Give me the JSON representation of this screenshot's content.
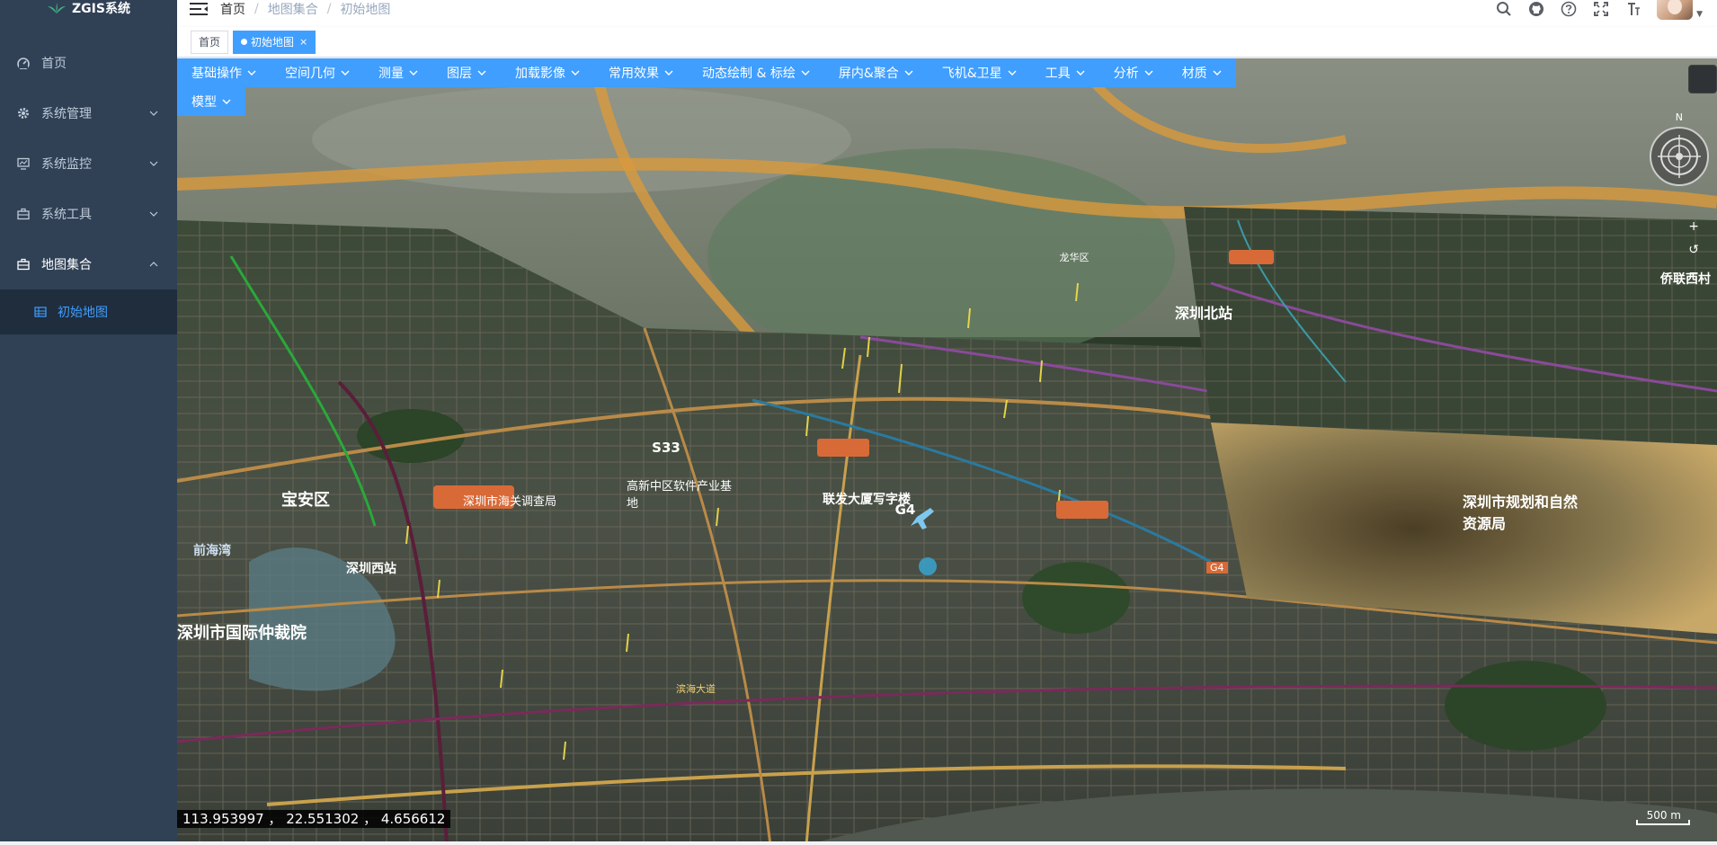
{
  "app": {
    "logo_text": "ZGIS系统"
  },
  "sidebar": {
    "items": [
      {
        "label": "首页",
        "icon": "dashboard-icon"
      },
      {
        "label": "系统管理",
        "icon": "gear-icon"
      },
      {
        "label": "系统监控",
        "icon": "monitor-icon"
      },
      {
        "label": "系统工具",
        "icon": "toolbox-icon"
      },
      {
        "label": "地图集合",
        "icon": "toolbox-icon"
      }
    ],
    "subitems": [
      {
        "label": "初始地图",
        "icon": "grid-icon"
      }
    ]
  },
  "breadcrumb": {
    "items": [
      "首页",
      "地图集合",
      "初始地图"
    ],
    "separator": "/"
  },
  "tags": [
    {
      "label": "首页"
    },
    {
      "label": "初始地图",
      "active": true
    }
  ],
  "toolbar": {
    "items": [
      "基础操作",
      "空间几何",
      "测量",
      "图层",
      "加载影像",
      "常用效果",
      "动态绘制 & 标绘",
      "屏内&聚合",
      "飞机&卫星",
      "工具",
      "分析",
      "材质"
    ],
    "row2": [
      "模型"
    ]
  },
  "map": {
    "coords": "113.953997 ，  22.551302 ，  4.656612",
    "scale": "500 m",
    "compass_north": "N",
    "zoom_in": "+",
    "zoom_reset": "↺",
    "zoom_out": "−",
    "place_labels": [
      "宝安区",
      "S33",
      "G4",
      "深圳北站",
      "龙华区",
      "深圳西站",
      "前海湾",
      "深圳市海关调查局",
      "高新中区软件产业基地",
      "联发大厦写字楼",
      "深圳市规划和自然资源局",
      "深圳市国际仲裁院",
      "侨联西村",
      "滨海大道",
      "G4"
    ]
  },
  "colors": {
    "sidebar_bg": "#304156",
    "accent": "#409eff",
    "submenu_bg": "#1f2d3d"
  }
}
